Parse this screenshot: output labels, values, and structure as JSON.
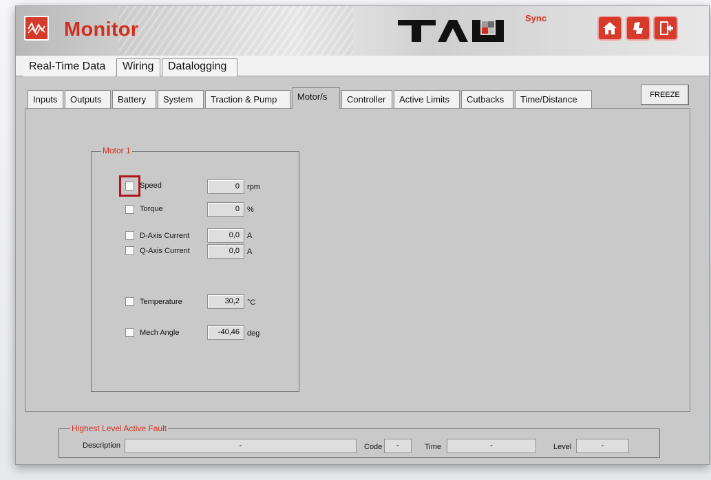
{
  "app": {
    "title": "Monitor",
    "logo_text": "TAU",
    "logo_sub": "Sync"
  },
  "header_buttons": [
    {
      "name": "home-button",
      "icon": "home-icon"
    },
    {
      "name": "seat-button",
      "icon": "seat-icon"
    },
    {
      "name": "exit-button",
      "icon": "exit-icon"
    }
  ],
  "main_tabs": [
    "Real-Time Data",
    "Wiring",
    "Datalogging"
  ],
  "sub_tabs": [
    "Inputs",
    "Outputs",
    "Battery",
    "System",
    "Traction & Pump",
    "Motor/s",
    "Controller",
    "Active Limits",
    "Cutbacks",
    "Time/Distance"
  ],
  "active_sub_tab": "Motor/s",
  "freeze_label": "FREEZE",
  "motor_group": {
    "title": "Motor 1",
    "rows": [
      {
        "label": "Speed",
        "value": "0",
        "unit": "rpm"
      },
      {
        "label": "Torque",
        "value": "0",
        "unit": "%"
      },
      {
        "label": "D-Axis Current",
        "value": "0,0",
        "unit": "A"
      },
      {
        "label": "Q-Axis Current",
        "value": "0,0",
        "unit": "A"
      },
      {
        "label": "Temperature",
        "value": "30,2",
        "unit": "°C"
      },
      {
        "label": "Mech Angle",
        "value": "-40,46",
        "unit": "deg"
      }
    ]
  },
  "fault": {
    "title": "Highest Level Active Fault",
    "description_label": "Description",
    "description_value": "-",
    "code_label": "Code",
    "code_value": "-",
    "time_label": "Time",
    "time_value": "-",
    "level_label": "Level",
    "level_value": "-"
  },
  "colors": {
    "accent": "#d22e1e",
    "highlight": "#b0141e",
    "panel": "#c9c9c9"
  }
}
